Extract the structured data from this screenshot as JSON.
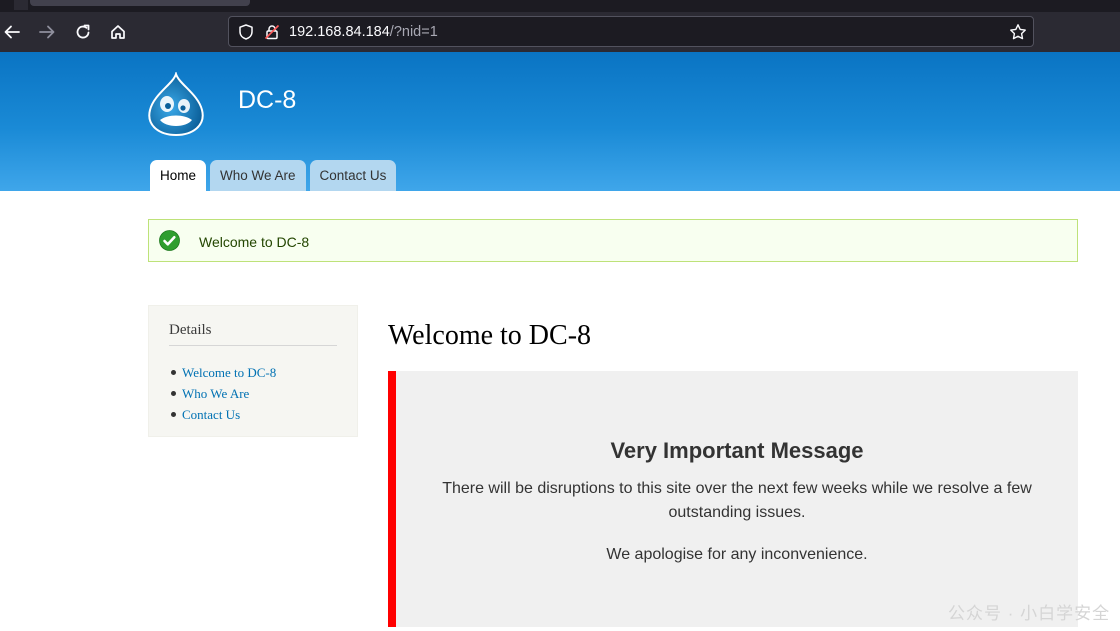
{
  "browser": {
    "url_host": "192.168.84.184",
    "url_path": "/?nid=1"
  },
  "site": {
    "name": "DC-8",
    "menu": [
      {
        "label": "Home",
        "active": true
      },
      {
        "label": "Who We Are",
        "active": false
      },
      {
        "label": "Contact Us",
        "active": false
      }
    ]
  },
  "status": {
    "message": "Welcome to DC-8"
  },
  "sidebar": {
    "title": "Details",
    "links": [
      "Welcome to DC-8",
      "Who We Are",
      "Contact Us"
    ]
  },
  "main": {
    "title": "Welcome to DC-8",
    "notice": {
      "heading": "Very Important Message",
      "paragraph1": "There will be disruptions to this site over the next few weeks while we resolve a few outstanding issues.",
      "paragraph2": "We apologise for any inconvenience."
    }
  },
  "watermark": "公众号 · 小白学安全",
  "colors": {
    "header_top": "#0a74c3",
    "header_bottom": "#3fa6ea",
    "notice_border": "#ff0000",
    "link": "#0071b3",
    "status_border": "#bee279"
  }
}
